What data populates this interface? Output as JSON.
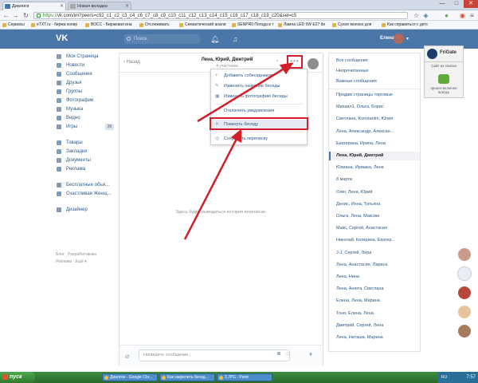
{
  "browser": {
    "tabs": [
      {
        "label": "Диалоги"
      },
      {
        "label": "Новая вкладка"
      }
    ],
    "window_controls": [
      "—",
      "□",
      "✕"
    ],
    "address": {
      "scheme": "https://",
      "rest": "vk.com/im?peers=c92_c1_c2_c3_c4_c6_c7_c8_c9_c10_c11_c12_c13_c14_c15_c16_c17_c18_c19_c20&sel=c5"
    },
    "bookmarks": [
      "Сервисы",
      "eTXT.ru - биржа копир",
      "ВОСС - Биржевая ина",
      "Отслеживать",
      "Семантический анали",
      "SENPR0 Погода в т",
      "Лампа LED 5W E27 de",
      "Сухое молоко для",
      "Как справиться с детс"
    ]
  },
  "vk_header": {
    "logo": "VK",
    "search_placeholder": "Поиск",
    "user_name": "Елена"
  },
  "left_nav": {
    "items": [
      {
        "label": "Моя Страница"
      },
      {
        "label": "Новости"
      },
      {
        "label": "Сообщения"
      },
      {
        "label": "Друзья"
      },
      {
        "label": "Группы"
      },
      {
        "label": "Фотографии"
      },
      {
        "label": "Музыка"
      },
      {
        "label": "Видео"
      },
      {
        "label": "Игры",
        "count": "36"
      },
      {
        "label": "Товары"
      },
      {
        "label": "Закладки"
      },
      {
        "label": "Документы"
      },
      {
        "label": "Реклама"
      },
      {
        "label": "Бесплатные объя..."
      },
      {
        "label": "Счастливая Женщ..."
      },
      {
        "label": "Дизайнер"
      }
    ],
    "footer": [
      "Блог",
      "Разработчикам",
      "Реклама",
      "Ещё"
    ]
  },
  "chat": {
    "back_label": "Назад",
    "title": "Лена, Юрий, Дмитрий",
    "subtitle": "4 участника",
    "more_label": "•••",
    "empty_text": "Здесь будет выводиться история переписки.",
    "message_placeholder": "Напишите сообщение..."
  },
  "dropdown": {
    "items": [
      {
        "label": "Добавить собеседников",
        "icon": "+"
      },
      {
        "label": "Изменить название беседы",
        "icon": "✎"
      },
      {
        "label": "Изменить фотографию беседы",
        "icon": "▣"
      },
      {
        "label": "Отключить уведомления",
        "icon": "♪"
      },
      {
        "label": "Покинуть беседу",
        "icon": "✕"
      },
      {
        "label": "Сохранить переписку",
        "icon": "◎"
      }
    ]
  },
  "conversations": {
    "filters": [
      "Все сообщения",
      "Непрочитанные",
      "Важные сообщения"
    ],
    "items": [
      "Продам страницы торговые",
      "Михаил1, Ольга, Борис",
      "Светлана, Konstantin, Юлия",
      "Лена, Александр, Алексан...",
      "Екатерина, Ирина, Лена",
      "Лена, Юрий, Дмитрий",
      "Юлиана, Иришка, Лена",
      "8 марта",
      "Олег, Лена, Юрий",
      "Денис, Инна, Татьяна",
      "Ольга, Лена, Максим",
      "Макс, Сергей, Анастасия",
      "Николай, Катерина, Екатер...",
      "J-J, Сергей, Лера",
      "Лена, Анастасия, Лариса",
      "Лена, Нина",
      "Лена, Анюта, Светлана",
      "Елена, Лена, Марина",
      "Тоня, Елена, Лена",
      "Дмитрий, Сергей, Лена",
      "Лена, Наташа, Марина"
    ],
    "selected_index": 5
  },
  "extension": {
    "name": "FriGate",
    "line1": "Сайт из списка",
    "line2": "прокси включен всегда"
  },
  "taskbar": {
    "start_label": "пуск",
    "items": [
      "Диалоги - Google Chr...",
      "Как закрепить бесед...",
      "3 JPG - Paint"
    ],
    "tray": "RU",
    "time": "7:57"
  }
}
